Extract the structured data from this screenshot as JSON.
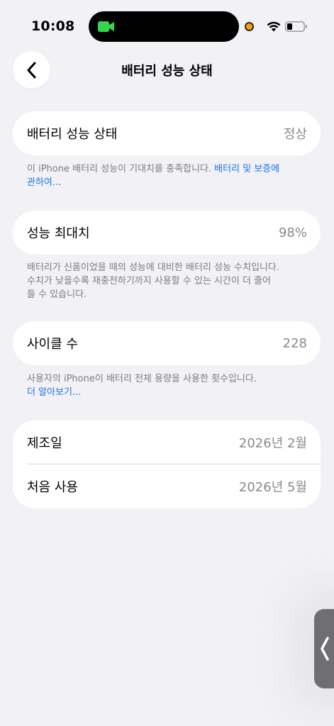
{
  "status_bar": {
    "time": "10:08"
  },
  "icons": {
    "facetime": "facetime-icon",
    "wifi": "wifi-icon",
    "battery": "battery-icon",
    "back": "chevron-left-icon",
    "side_handle": "chevron-left-icon"
  },
  "colors": {
    "background": "#f2f2f6",
    "card": "#ffffff",
    "link": "#1a73e8",
    "secondary_text": "#8a8a8e",
    "facetime_green": "#32d74b",
    "privacy_orange": "#ff9f0a"
  },
  "nav": {
    "title": "배터리 성능 상태"
  },
  "battery_health": {
    "label": "배터리 성능 상태",
    "value": "정상",
    "footer_text": "이 iPhone 배터리 성능이 기대치를 충족합니다. ",
    "footer_link_line1": "배터리 및 보증에",
    "footer_link_line2": "관하여..."
  },
  "max_capacity": {
    "label": "성능 최대치",
    "value": "98%",
    "footer_line1": "배터리가 신품이었을 때의 성능에 대비한 배터리 성능 수치입니다.",
    "footer_line2": "수치가 낮을수록 재충전하기까지 사용할 수 있는 시간이 더 줄어",
    "footer_line3": "들 수 있습니다."
  },
  "cycle_count": {
    "label": "사이클 수",
    "value": "228",
    "footer_text": "사용자의 iPhone이 배터리 전체 용량을 사용한 횟수입니다.",
    "footer_link": "더 알아보기..."
  },
  "dates": {
    "manufacture_label": "제조일",
    "manufacture_value": "2026년 2월",
    "first_use_label": "처음 사용",
    "first_use_value": "2026년 5월"
  }
}
